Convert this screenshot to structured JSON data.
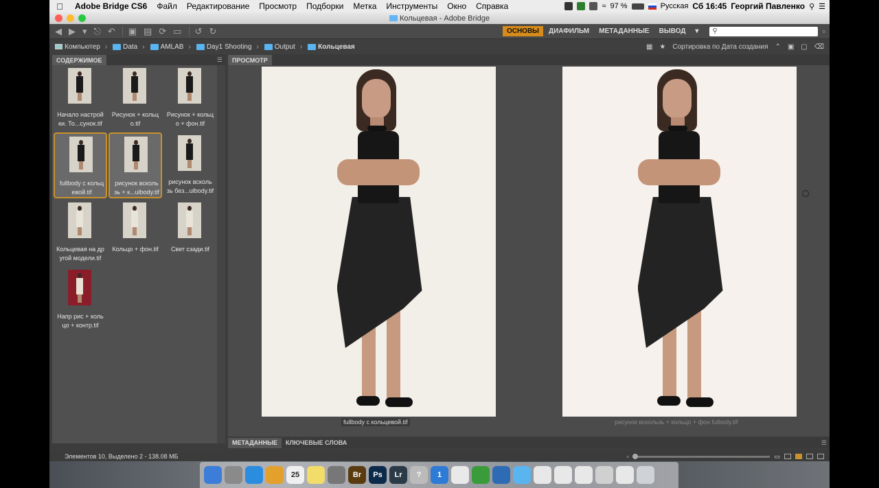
{
  "menubar": {
    "app_name": "Adobe Bridge CS6",
    "items": [
      "Файл",
      "Редактирование",
      "Просмотр",
      "Подборки",
      "Метка",
      "Инструменты",
      "Окно",
      "Справка"
    ],
    "battery": "97 %",
    "input_language": "Русская",
    "clock": "Сб 16:45",
    "user": "Георгий Павленко"
  },
  "window": {
    "title": "Кольцевая - Adobe Bridge"
  },
  "workspaces": {
    "items": [
      "ОСНОВЫ",
      "ДИАФИЛЬМ",
      "МЕТАДАННЫЕ",
      "ВЫВОД"
    ]
  },
  "path": {
    "crumbs": [
      "Компьютер",
      "Data",
      "AMLAB",
      "Day1 Shooting",
      "Output",
      "Кольцевая"
    ],
    "sort_label": "Сортировка по Дата создания"
  },
  "content": {
    "tab": "СОДЕРЖИМОЕ",
    "files": [
      {
        "line1": "Начало настрой",
        "line2": "ки. То...сунок.tif",
        "thumb": "black",
        "selected": false
      },
      {
        "line1": "Рисунок + кольц",
        "line2": "о.tif",
        "thumb": "black",
        "selected": false
      },
      {
        "line1": "Рисунок + кольц",
        "line2": "о + фон.tif",
        "thumb": "black",
        "selected": false
      },
      {
        "line1": "fullbody с кольц",
        "line2": "евой.tif",
        "thumb": "black",
        "selected": true
      },
      {
        "line1": "рисунок всколь",
        "line2": "зь + к...ulbody.tif",
        "thumb": "black",
        "selected": true
      },
      {
        "line1": "рисунок всколь",
        "line2": "зь без...ulbody.tif",
        "thumb": "black",
        "selected": false
      },
      {
        "line1": "Кольцевая на др",
        "line2": "угой модели.tif",
        "thumb": "white",
        "selected": false
      },
      {
        "line1": "Кольцо + фон.tif",
        "line2": "",
        "thumb": "white",
        "selected": false
      },
      {
        "line1": "Свет сзади.tif",
        "line2": "",
        "thumb": "white",
        "selected": false
      },
      {
        "line1": "Напр рис + коль",
        "line2": "цо + контр.tif",
        "thumb": "red",
        "selected": false
      }
    ]
  },
  "preview": {
    "tab": "ПРОСМОТР",
    "left_caption": "fullbody с кольцевой.tif",
    "right_caption": "рисунок вскользь + кольцо + фон fulbody.tif"
  },
  "meta_tabs": [
    "МЕТАДАННЫЕ",
    "КЛЮЧЕВЫЕ СЛОВА"
  ],
  "status": {
    "text": "Элементов 10, Выделено 2 - 138.08 МБ"
  },
  "dock": {
    "items": [
      {
        "name": "finder",
        "label": "",
        "color": "#3b7dd8"
      },
      {
        "name": "launchpad",
        "label": "",
        "color": "#8a8a8a"
      },
      {
        "name": "safari",
        "label": "",
        "color": "#2a8de0"
      },
      {
        "name": "chrome",
        "label": "",
        "color": "#e3a12b"
      },
      {
        "name": "calendar",
        "label": "25",
        "color": "#f0f0f0"
      },
      {
        "name": "notes",
        "label": "",
        "color": "#f2dc6a"
      },
      {
        "name": "system-preferences",
        "label": "",
        "color": "#777"
      },
      {
        "name": "bridge",
        "label": "Br",
        "color": "#5a3b10"
      },
      {
        "name": "photoshop",
        "label": "Ps",
        "color": "#0c2a4a"
      },
      {
        "name": "lightroom",
        "label": "Lr",
        "color": "#2b3a47"
      },
      {
        "name": "help",
        "label": "?",
        "color": "#bbb"
      },
      {
        "name": "1password",
        "label": "1",
        "color": "#2e7bd6"
      },
      {
        "name": "textedit",
        "label": "",
        "color": "#e9e9e9"
      },
      {
        "name": "utorrent",
        "label": "",
        "color": "#3a9b3a"
      },
      {
        "name": "quicktime",
        "label": "",
        "color": "#2d6bb5"
      },
      {
        "name": "folder",
        "label": "",
        "color": "#5ab4f0"
      },
      {
        "name": "doc1",
        "label": "",
        "color": "#e8e8e8"
      },
      {
        "name": "doc2",
        "label": "",
        "color": "#e8e8e8"
      },
      {
        "name": "doc3",
        "label": "",
        "color": "#e8e8e8"
      },
      {
        "name": "doc4",
        "label": "",
        "color": "#d0d0d0"
      },
      {
        "name": "doc5",
        "label": "",
        "color": "#e8e8e8"
      },
      {
        "name": "trash",
        "label": "",
        "color": "#cfd2d6"
      }
    ]
  },
  "colors": {
    "accent": "#d78b1a",
    "selection_border": "#c9922c",
    "panel": "#505050"
  }
}
